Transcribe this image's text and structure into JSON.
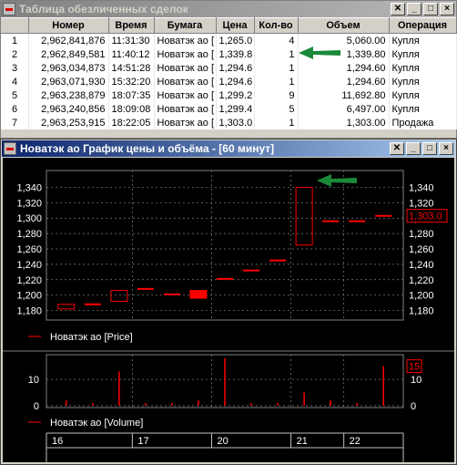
{
  "deals_window": {
    "title": "Таблица обезличенных сделок",
    "columns": [
      "Номер",
      "Время",
      "Бумага",
      "Цена",
      "Кол-во",
      "Объем",
      "Операция"
    ],
    "rows": [
      {
        "idx": "1",
        "number": "2,962,841,876",
        "time": "11:31:30",
        "security": "Новатэк ао [",
        "price": "1,265.0",
        "qty": "4",
        "volume": "5,060.00",
        "op": "Купля"
      },
      {
        "idx": "2",
        "number": "2,962,849,581",
        "time": "11:40:12",
        "security": "Новатэк ао [",
        "price": "1,339.8",
        "qty": "1",
        "volume": "1,339.80",
        "op": "Купля"
      },
      {
        "idx": "3",
        "number": "2,963,034,873",
        "time": "14:51:28",
        "security": "Новатэк ао [",
        "price": "1,294.6",
        "qty": "1",
        "volume": "1,294.60",
        "op": "Купля"
      },
      {
        "idx": "4",
        "number": "2,963,071,930",
        "time": "15:32:20",
        "security": "Новатэк ао [",
        "price": "1,294.6",
        "qty": "1",
        "volume": "1,294.60",
        "op": "Купля"
      },
      {
        "idx": "5",
        "number": "2,963,238,879",
        "time": "18:07:35",
        "security": "Новатэк ао [",
        "price": "1,299.2",
        "qty": "9",
        "volume": "11,692.80",
        "op": "Купля"
      },
      {
        "idx": "6",
        "number": "2,963,240,856",
        "time": "18:09:08",
        "security": "Новатэк ао [",
        "price": "1,299.4",
        "qty": "5",
        "volume": "6,497.00",
        "op": "Купля"
      },
      {
        "idx": "7",
        "number": "2,963,253,915",
        "time": "18:22:05",
        "security": "Новатэк ао [",
        "price": "1,303.0",
        "qty": "1",
        "volume": "1,303.00",
        "op": "Продажа"
      }
    ]
  },
  "chart_window": {
    "title": "Новатэк ао График цены и объёма - [60 минут]",
    "price_legend": "Новатэк ао [Price]",
    "volume_legend": "Новатэк ао [Volume]",
    "price_ticks": [
      "1,340",
      "1,320",
      "1,300",
      "1,280",
      "1,260",
      "1,240",
      "1,220",
      "1,200",
      "1,180"
    ],
    "current_price_label": "1,303.0",
    "volume_ticks": [
      "10",
      "0"
    ],
    "current_volume_label": "15",
    "date_labels": [
      "16",
      "17",
      "20",
      "21",
      "22"
    ]
  },
  "colors": {
    "arrow": "#1a8a3a",
    "candle": "#ff0000",
    "chart_bg": "#000000",
    "grid": "#808080"
  },
  "chart_data": [
    {
      "type": "candlestick",
      "title": "Новатэк ао [Price]",
      "ylim": [
        1170,
        1350
      ],
      "candles": [
        {
          "open": 1182,
          "close": 1188,
          "high": 1188,
          "low": 1182
        },
        {
          "open": 1188,
          "close": 1188,
          "high": 1188,
          "low": 1188
        },
        {
          "open": 1192,
          "close": 1206,
          "high": 1206,
          "low": 1192
        },
        {
          "open": 1208,
          "close": 1208,
          "high": 1208,
          "low": 1208
        },
        {
          "open": 1201,
          "close": 1201,
          "high": 1201,
          "low": 1201
        },
        {
          "open": 1206,
          "close": 1196,
          "high": 1206,
          "low": 1196
        },
        {
          "open": 1221,
          "close": 1221,
          "high": 1221,
          "low": 1221
        },
        {
          "open": 1232,
          "close": 1232,
          "high": 1232,
          "low": 1232
        },
        {
          "open": 1245,
          "close": 1245,
          "high": 1245,
          "low": 1245
        },
        {
          "open": 1265,
          "close": 1339.8,
          "high": 1339.8,
          "low": 1265
        },
        {
          "open": 1296,
          "close": 1296,
          "high": 1296,
          "low": 1296
        },
        {
          "open": 1296,
          "close": 1296,
          "high": 1296,
          "low": 1296
        },
        {
          "open": 1303,
          "close": 1303,
          "high": 1303,
          "low": 1303
        }
      ]
    },
    {
      "type": "bar",
      "title": "Новатэк ао [Volume]",
      "ylim": [
        0,
        18
      ],
      "values": [
        2,
        1,
        13,
        1,
        1,
        2,
        18,
        1,
        1,
        5,
        2,
        1,
        15
      ]
    }
  ]
}
